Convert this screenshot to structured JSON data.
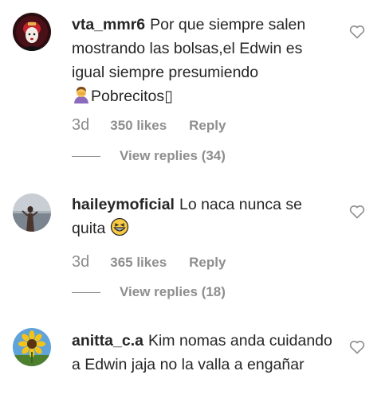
{
  "comments": [
    {
      "username": "vta_mmr6",
      "text": "Por que siempre salen mostrando las bolsas,el Edwin es igual siempre presumiendo",
      "text_after_emoji": "Pobrecitos▯",
      "emoji": "person-facepalming-emoji",
      "age": "3d",
      "likes": "350 likes",
      "reply_label": "Reply",
      "view_replies": "View replies (34)"
    },
    {
      "username": "haileymoficial",
      "text": "Lo naca nunca se quita",
      "emoji": "grinning-squinting-face-emoji",
      "age": "3d",
      "likes": "365 likes",
      "reply_label": "Reply",
      "view_replies": "View replies (18)"
    },
    {
      "username": "anitta_c.a",
      "text": "Kim nomas anda cuidando a Edwin jaja no la valla a engañar"
    }
  ],
  "icons": {
    "like": "heart-outline-icon"
  },
  "colors": {
    "secondary_text": "#8e8e8e",
    "primary_text": "#262626"
  }
}
